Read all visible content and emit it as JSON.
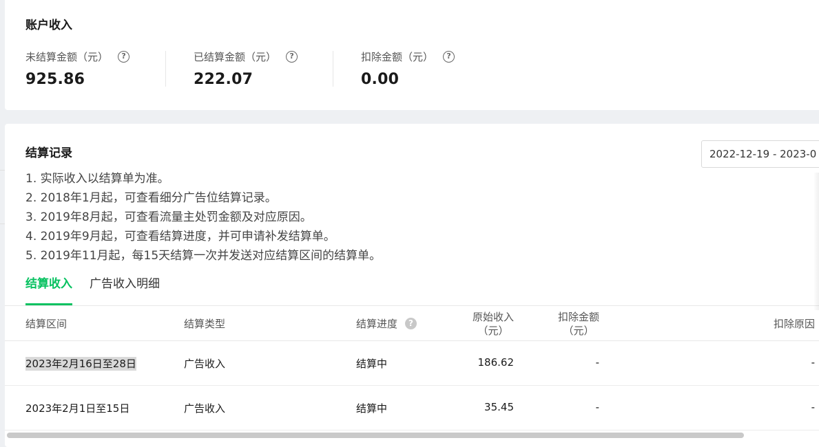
{
  "income": {
    "title": "账户收入",
    "stats": [
      {
        "label": "未结算金额（元）",
        "value": "925.86",
        "icon": "question-circle-icon"
      },
      {
        "label": "已结算金额（元）",
        "value": "222.07",
        "icon": "question-circle-icon"
      },
      {
        "label": "扣除金额（元）",
        "value": "0.00",
        "icon": "question-circle-icon"
      }
    ]
  },
  "settlement": {
    "title": "结算记录",
    "date_range": "2022-12-19 - 2023-0",
    "notes": [
      "1. 实际收入以结算单为准。",
      "2. 2018年1月起，可查看细分广告位结算记录。",
      "3. 2019年8月起，可查看流量主处罚金额及对应原因。",
      "4. 2019年9月起，可查看结算进度，并可申请补发结算单。",
      "5. 2019年11月起，每15天结算一次并发送对应结算区间的结算单。"
    ],
    "tabs": [
      {
        "label": "结算收入",
        "active": true
      },
      {
        "label": "广告收入明细",
        "active": false
      }
    ],
    "table": {
      "headers": {
        "period": "结算区间",
        "type": "结算类型",
        "progress": "结算进度",
        "original_line1": "原始收入",
        "original_line2": "（元）",
        "deduct_line1": "扣除金额",
        "deduct_line2": "（元）",
        "reason": "扣除原因"
      },
      "rows": [
        {
          "period": "2023年2月16日至28日",
          "type": "广告收入",
          "progress": "结算中",
          "original": "186.62",
          "deduct": "-",
          "reason": "-"
        },
        {
          "period": "2023年2月1日至15日",
          "type": "广告收入",
          "progress": "结算中",
          "original": "35.45",
          "deduct": "-",
          "reason": "-"
        }
      ]
    }
  },
  "colors": {
    "accent": "#07c160",
    "highlight": "#d9d9d9"
  }
}
